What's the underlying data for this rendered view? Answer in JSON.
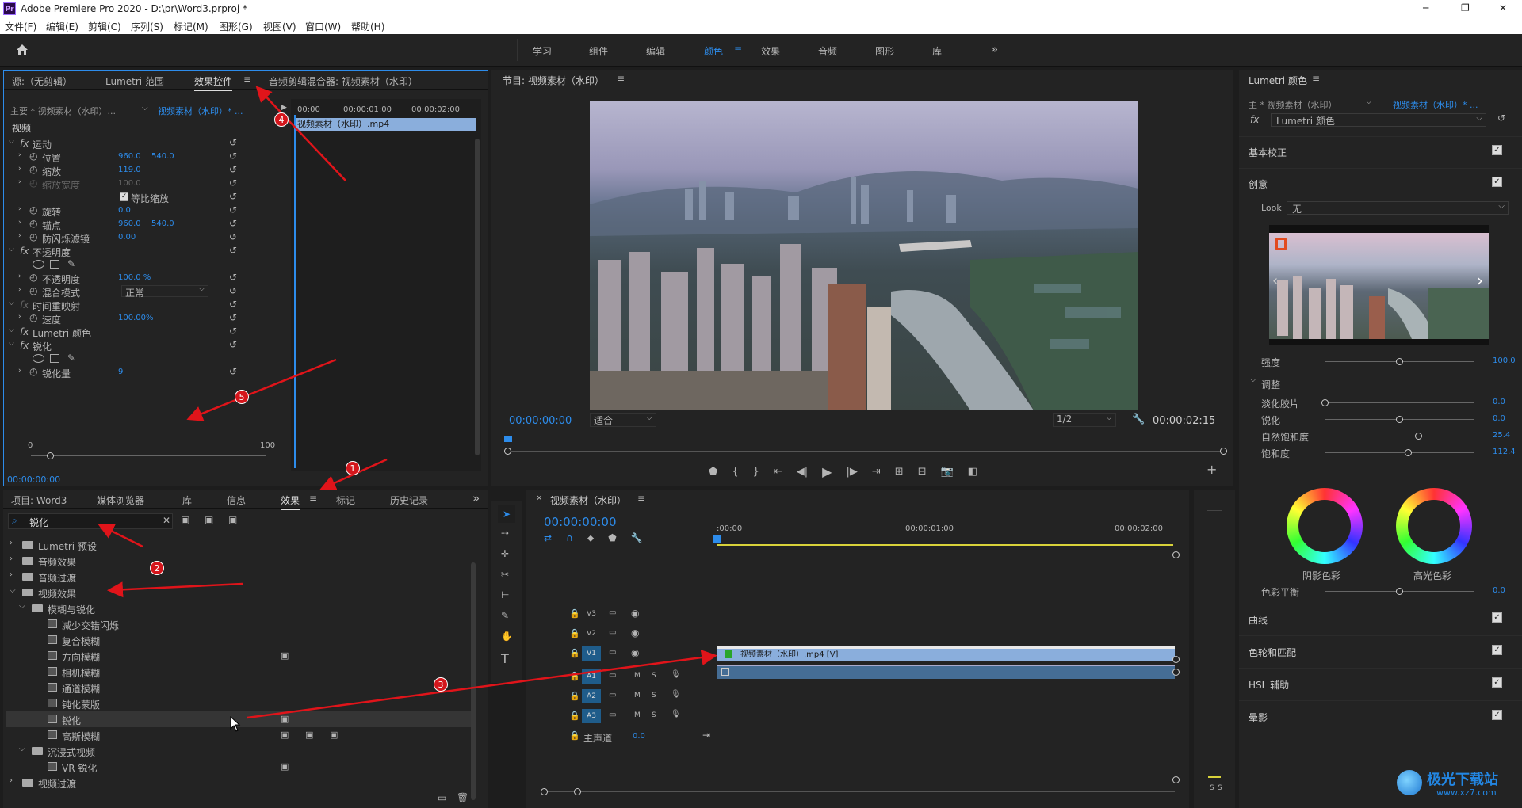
{
  "title_bar": {
    "app_title": "Adobe Premiere Pro 2020 - D:\\pr\\Word3.prproj *",
    "minimize": "─",
    "maximize": "❐",
    "close": "✕"
  },
  "menu": [
    "文件(F)",
    "编辑(E)",
    "剪辑(C)",
    "序列(S)",
    "标记(M)",
    "图形(G)",
    "视图(V)",
    "窗口(W)",
    "帮助(H)"
  ],
  "workspaces": {
    "items": [
      "学习",
      "组件",
      "编辑",
      "颜色",
      "效果",
      "音频",
      "图形",
      "库"
    ],
    "active": "颜色",
    "more": "»"
  },
  "source_panel": {
    "tabs": [
      "源:（无剪辑）",
      "Lumetri 范围",
      "效果控件",
      "音频剪辑混合器: 视频素材（水印）"
    ],
    "active_tab": "效果控件",
    "master_label": "主要 * 视频素材（水印）...",
    "clip_label": "视频素材（水印）* ...",
    "timeline_ruler": [
      "00:00",
      "00:00:01:00",
      "00:00:02:00"
    ],
    "clip_bar": "视频素材（水印）.mp4",
    "section_video": "视频",
    "rows": [
      {
        "label": "运动",
        "fx": true
      },
      {
        "label": "位置",
        "v1": "960.0",
        "v2": "540.0"
      },
      {
        "label": "缩放",
        "v1": "119.0"
      },
      {
        "label": "缩放宽度",
        "v1": "100.0",
        "dim": true
      },
      {
        "label": "等比缩放",
        "checkbox": true
      },
      {
        "label": "旋转",
        "v1": "0.0"
      },
      {
        "label": "锚点",
        "v1": "960.0",
        "v2": "540.0"
      },
      {
        "label": "防闪烁滤镜",
        "v1": "0.00"
      },
      {
        "label": "不透明度",
        "fx": true
      },
      {
        "label": "shapes"
      },
      {
        "label": "不透明度",
        "v1": "100.0 %"
      },
      {
        "label": "混合模式",
        "select": "正常"
      },
      {
        "label": "时间重映射",
        "fx": true,
        "dim": true
      },
      {
        "label": "速度",
        "v1": "100.00%"
      },
      {
        "label": "Lumetri 颜色",
        "fx": true
      },
      {
        "label": "锐化",
        "fx": true
      },
      {
        "label": "shapes"
      },
      {
        "label": "锐化量",
        "v1": "9"
      }
    ],
    "slider_min": "0",
    "slider_max": "100",
    "timecode": "00:00:00:00"
  },
  "program": {
    "title": "节目: 视频素材（水印）",
    "timecode": "00:00:00:00",
    "fit": "适合",
    "resolution": "1/2",
    "duration": "00:00:02:15"
  },
  "lumetri": {
    "title": "Lumetri 颜色",
    "master": "主 * 视频素材（水印）",
    "clip": "视频素材（水印）* ...",
    "fx_name": "Lumetri 颜色",
    "basic": "基本校正",
    "creative": "创意",
    "look_label": "Look",
    "look_value": "无",
    "intensity_label": "强度",
    "intensity_value": "100.0",
    "intensity": 1.0,
    "adjust": "调整",
    "sliders": [
      {
        "label": "淡化胶片",
        "value": "0.0",
        "pos": 0.0
      },
      {
        "label": "锐化",
        "value": "0.0",
        "pos": 0.5
      },
      {
        "label": "自然饱和度",
        "value": "25.4",
        "pos": 0.627
      },
      {
        "label": "饱和度",
        "value": "112.4",
        "pos": 0.56
      }
    ],
    "shadow_tint": "阴影色彩",
    "highlight_tint": "高光色彩",
    "balance_label": "色彩平衡",
    "balance_value": "0.0",
    "sections": [
      "曲线",
      "色轮和匹配",
      "HSL 辅助",
      "晕影"
    ]
  },
  "project_panel": {
    "tabs": [
      "项目: Word3",
      "媒体浏览器",
      "库",
      "信息",
      "效果",
      "标记",
      "历史记录"
    ],
    "active_tab": "效果",
    "search_value": "锐化",
    "tree": [
      {
        "label": "Lumetri 预设",
        "depth": 0,
        "folder": true,
        "open": false
      },
      {
        "label": "音频效果",
        "depth": 0,
        "folder": true,
        "open": false
      },
      {
        "label": "音频过渡",
        "depth": 0,
        "folder": true,
        "open": false
      },
      {
        "label": "视频效果",
        "depth": 0,
        "folder": true,
        "open": true
      },
      {
        "label": "模糊与锐化",
        "depth": 1,
        "folder": true,
        "open": true
      },
      {
        "label": "减少交错闪烁",
        "depth": 2
      },
      {
        "label": "复合模糊",
        "depth": 2
      },
      {
        "label": "方向模糊",
        "depth": 2,
        "badges": 1
      },
      {
        "label": "相机模糊",
        "depth": 2
      },
      {
        "label": "通道模糊",
        "depth": 2
      },
      {
        "label": "钝化蒙版",
        "depth": 2
      },
      {
        "label": "锐化",
        "depth": 2,
        "badges": 1,
        "selected": true
      },
      {
        "label": "高斯模糊",
        "depth": 2,
        "badges": 3
      },
      {
        "label": "沉浸式视频",
        "depth": 1,
        "folder": true,
        "open": true
      },
      {
        "label": "VR 锐化",
        "depth": 2,
        "badges": 1
      },
      {
        "label": "视频过渡",
        "depth": 0,
        "folder": true,
        "open": false
      }
    ]
  },
  "timeline": {
    "title": "视频素材（水印）",
    "timecode": "00:00:00:00",
    "ruler": [
      ":00:00",
      "00:00:01:00",
      "00:00:02:00"
    ],
    "tracks": [
      "V3",
      "V2",
      "V1",
      "A1",
      "A2",
      "A3"
    ],
    "master": "主声道",
    "master_value": "0.0",
    "clip_label": "视频素材（水印）.mp4 [V]",
    "M": "M",
    "S": "S"
  },
  "annotations": [
    "1",
    "2",
    "3",
    "4",
    "5"
  ],
  "watermark": {
    "name": "极光下载站",
    "url": "www.xz7.com"
  }
}
